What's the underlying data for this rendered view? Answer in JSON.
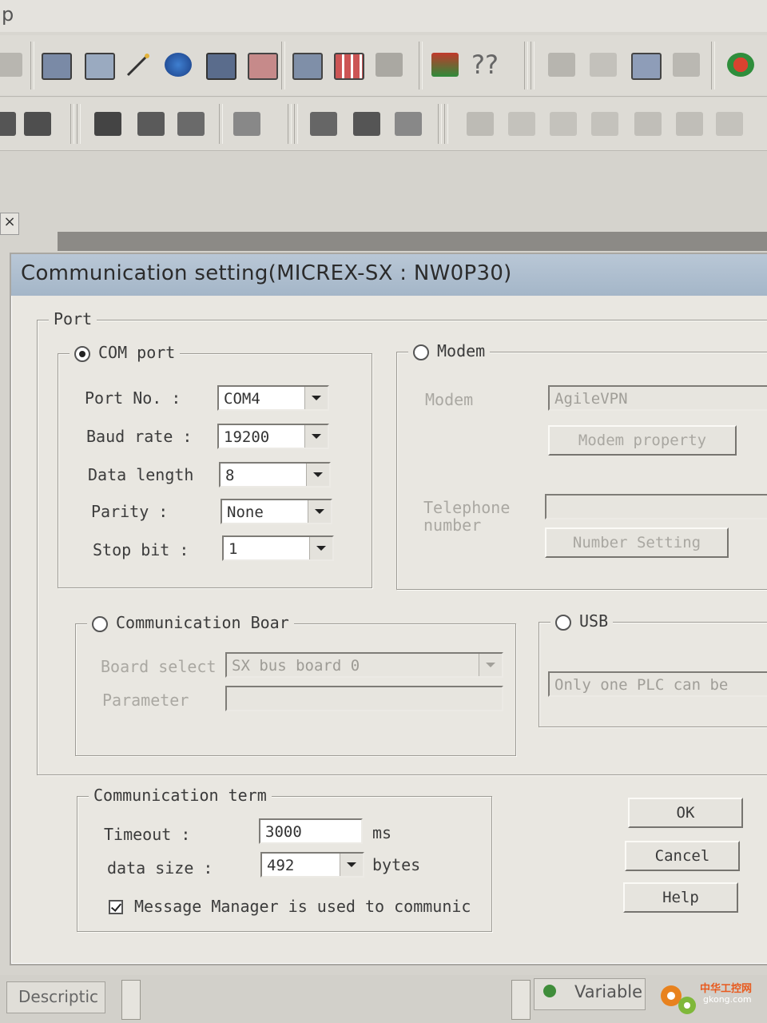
{
  "app": {
    "title_fragment": "p"
  },
  "toolbar": {
    "help_glyph": "??",
    "icons_row1": [
      "zoom-icon",
      "new-window-icon",
      "window-icon",
      "wand-icon",
      "globe-icon",
      "monitor-icon",
      "chart-window-icon",
      "cascade-icon",
      "grid-icon",
      "puzzle-icon",
      "pencil-tool-icon",
      "help-icon",
      "download-icon",
      "upload-icon",
      "compare-icon",
      "verify-icon",
      "refresh-icon"
    ],
    "icons_row2": [
      "block-icon",
      "block2-icon",
      "tree-icon",
      "block3-icon",
      "network-icon",
      "branch-icon",
      "align-left-icon",
      "align-bar-icon",
      "document-icon",
      "contact-no-icon",
      "contact-nc-icon",
      "coil-icon",
      "coil2-icon",
      "func-icon",
      "func2-icon",
      "jump-icon"
    ]
  },
  "dialog": {
    "title": "Communication setting(MICREX-SX : NW0P30)",
    "port": {
      "legend": "Port",
      "com": {
        "label": "COM port",
        "selected": true,
        "port_no": {
          "label": "Port No. :",
          "value": "COM4"
        },
        "baud_rate": {
          "label": "Baud rate :",
          "value": "19200"
        },
        "data_length": {
          "label": "Data length",
          "value": "8"
        },
        "parity": {
          "label": "Parity :",
          "value": "None"
        },
        "stop_bit": {
          "label": "Stop bit :",
          "value": "1"
        }
      },
      "modem": {
        "label": "Modem",
        "selected": false,
        "modem_label": "Modem",
        "modem_value": "AgileVPN",
        "modem_property_button": "Modem property",
        "telephone_label": "Telephone number",
        "telephone_value": "",
        "number_setting_button": "Number Setting"
      },
      "comm_board": {
        "label": "Communication Boar",
        "selected": false,
        "board_select_label": "Board select",
        "board_select_value": "SX bus board 0",
        "parameter_label": "Parameter",
        "parameter_value": ""
      },
      "usb": {
        "label": "USB",
        "selected": false,
        "note": "Only one PLC can be"
      }
    },
    "term": {
      "legend": "Communication term",
      "timeout": {
        "label": "Timeout :",
        "value": "3000",
        "unit": "ms"
      },
      "data_size": {
        "label": "data size :",
        "value": "492",
        "unit": "bytes"
      },
      "message_manager": {
        "label": "Message Manager is used to communic",
        "checked": true
      }
    },
    "buttons": {
      "ok": "OK",
      "cancel": "Cancel",
      "help": "Help"
    }
  },
  "bottom": {
    "description_tab": "Descriptic",
    "variable_tab": "Variable",
    "watermark_cn": "中华工控网",
    "watermark_url": "gkong.com"
  },
  "colors": {
    "title_bar": "#a4b6c8",
    "dialog_bg": "#e9e7e1",
    "brand_orange": "#e85a1e"
  }
}
